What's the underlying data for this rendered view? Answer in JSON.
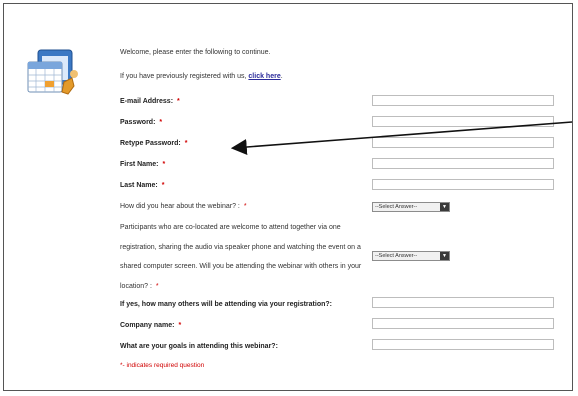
{
  "intro": {
    "welcome": "Welcome, please enter the following to continue.",
    "registered_prefix": "If you have previously registered with us,",
    "click_here": "click here",
    "registered_suffix": "."
  },
  "required_marker": "*",
  "fields": {
    "email": "E-mail Address:",
    "password": "Password:",
    "retype_password": "Retype Password:",
    "first_name": "First Name:",
    "last_name": "Last Name:",
    "hear_about": "How did you hear about the webinar? :",
    "co_located": "Participants who are co-located are welcome to attend together via one registration, sharing the audio via speaker phone and watching the event on a shared computer screen. Will you be attending the webinar with others in your location? :",
    "how_many": "If yes, how many others will be attending via your registration?:",
    "company": "Company name:",
    "goals": "What are your goals in attending this webinar?:"
  },
  "select_placeholder": "--Select Answer--",
  "select_arrow": "▼",
  "required_note": "*- indicates required question"
}
